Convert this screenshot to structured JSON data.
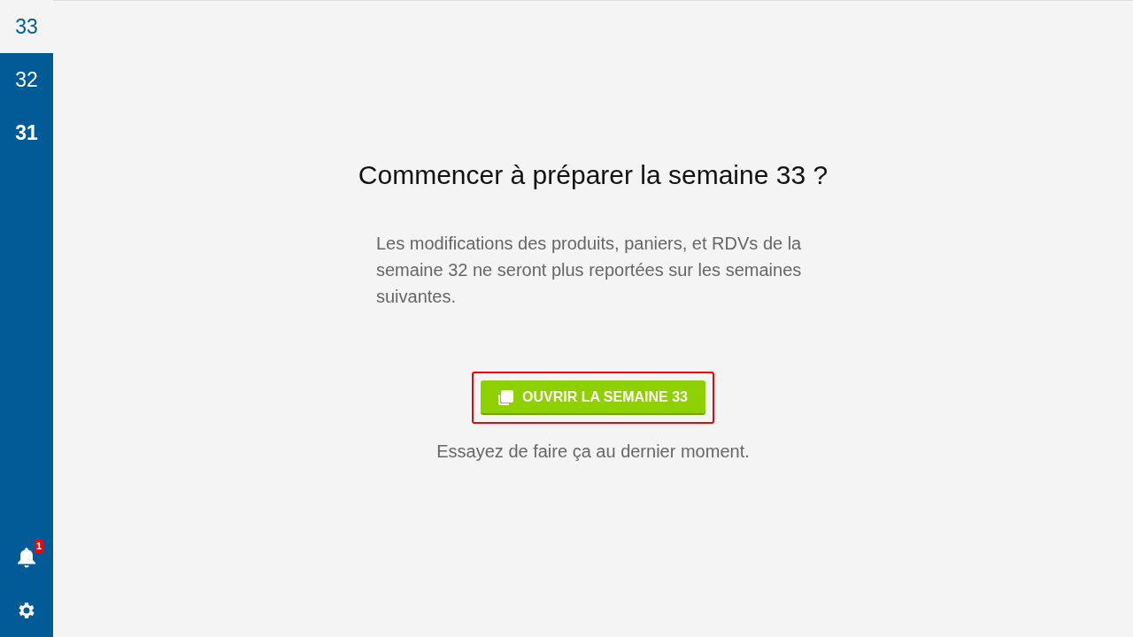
{
  "sidebar": {
    "weeks": [
      {
        "label": "33",
        "selected": true,
        "bold": false
      },
      {
        "label": "32",
        "selected": false,
        "bold": false
      },
      {
        "label": "31",
        "selected": false,
        "bold": true
      }
    ],
    "notifications": {
      "badge": "1"
    }
  },
  "main": {
    "title": "Commencer à préparer la semaine 33 ?",
    "description": "Les modifications des produits, paniers, et RDVs de la semaine 32 ne seront plus reportées sur les semaines suivantes.",
    "button": {
      "label": "OUVRIR LA SEMAINE 33",
      "highlighted": true
    },
    "hint": "Essayez de faire ça au dernier moment."
  }
}
